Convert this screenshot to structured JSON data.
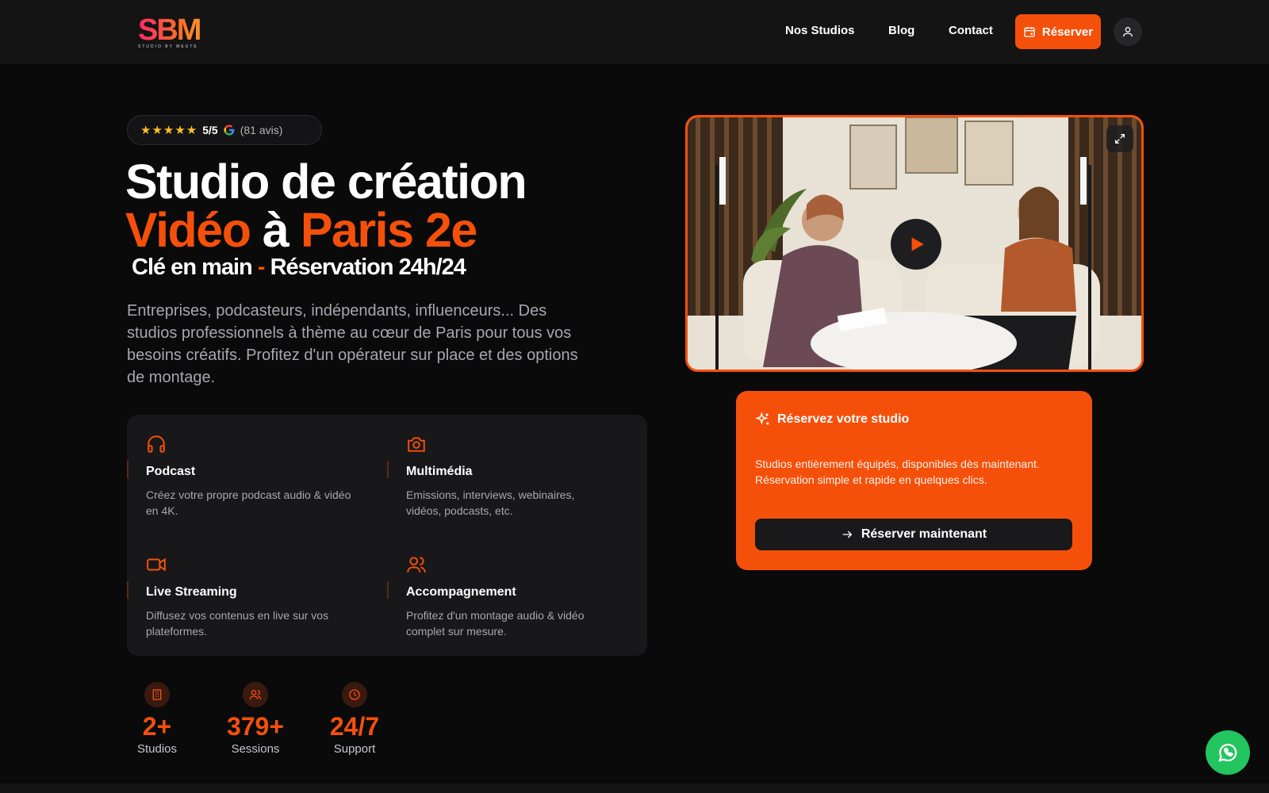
{
  "nav": {
    "logo_letters": "SBM",
    "logo_tagline": "STUDIO BY MEUTE",
    "links": [
      "Nos Studios",
      "Blog",
      "Contact"
    ],
    "reserve_label": "Réserver"
  },
  "hero": {
    "rating": {
      "stars": "★★★★★",
      "score": "5/5",
      "reviews": "(81 avis)"
    },
    "title_line1": "Studio de création",
    "title_line2": {
      "part1": "Vidéo",
      "part2": " à ",
      "part3": "Paris 2e"
    },
    "subtitle": {
      "part1": "Clé en main",
      "separator": " - ",
      "part2": "Réservation 24h/24"
    },
    "description": "Entreprises, podcasteurs, indépendants, influenceurs... Des studios professionnels à thème au cœur de Paris pour tous vos besoins créatifs. Profitez d'un opérateur sur place et des options de montage."
  },
  "features": [
    {
      "icon": "headphones-icon",
      "title": "Podcast",
      "desc": "Créez votre propre podcast audio & vidéo en 4K."
    },
    {
      "icon": "camera-icon",
      "title": "Multimédia",
      "desc": "Emissions, interviews, webinaires, vidéos, podcasts, etc."
    },
    {
      "icon": "video-camera-icon",
      "title": "Live Streaming",
      "desc": "Diffusez vos contenus en live sur vos plateformes."
    },
    {
      "icon": "users-icon",
      "title": "Accompagnement",
      "desc": "Profitez d'un montage audio & vidéo complet sur mesure."
    }
  ],
  "stats": [
    {
      "icon": "building-icon",
      "value": "2+",
      "label": "Studios"
    },
    {
      "icon": "users-icon",
      "value": "379+",
      "label": "Sessions"
    },
    {
      "icon": "clock-icon",
      "value": "24/7",
      "label": "Support"
    }
  ],
  "booking": {
    "title": "Réservez votre studio",
    "desc": "Studios entièrement équipés, disponibles dès maintenant. Réservation simple et rapide en quelques clics.",
    "cta": "Réserver maintenant"
  },
  "colors": {
    "accent": "#f5500a",
    "background": "#0a0a0b",
    "whatsapp": "#22c55e"
  }
}
